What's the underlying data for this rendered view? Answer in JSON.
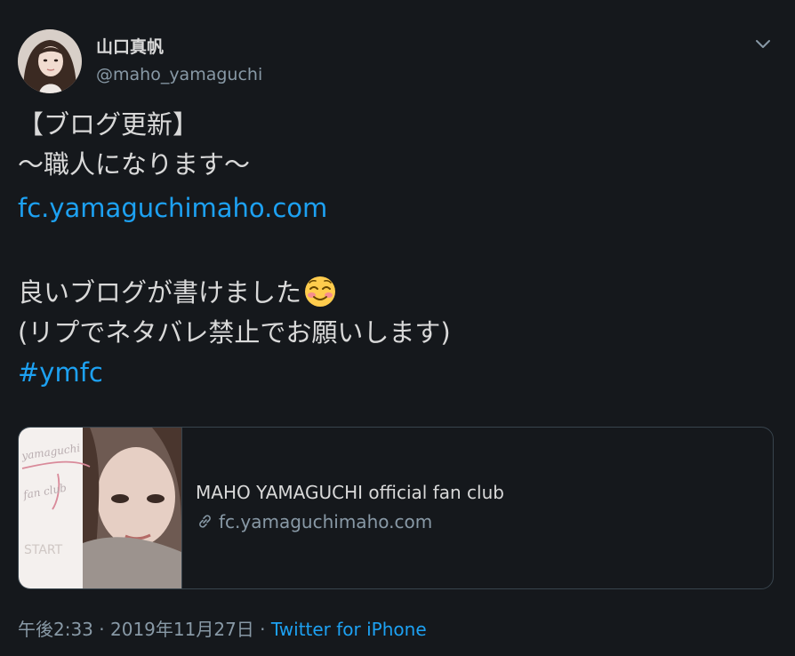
{
  "author": {
    "display_name": "山口真帆",
    "handle": "@maho_yamaguchi"
  },
  "tweet": {
    "line1": "【ブログ更新】",
    "line2": "〜職人になります〜",
    "link": "fc.yamaguchimaho.com",
    "line4": "良いブログが書けました",
    "line4_emoji": "smiling-face-icon",
    "line5": "(リプでネタバレ禁止でお願いします)",
    "hashtag": "#ymfc"
  },
  "card": {
    "title": "MAHO YAMAGUCHI official fan club",
    "domain": "fc.yamaguchimaho.com",
    "thumb_text_1": "yamaguchi",
    "thumb_text_2": "fan club",
    "thumb_text_3": "START"
  },
  "meta": {
    "time": "午後2:33",
    "separator1": "·",
    "date": "2019年11月27日",
    "separator2": "·",
    "source": "Twitter for iPhone"
  },
  "colors": {
    "background": "#15181c",
    "text": "#d9d9d9",
    "muted": "#8899a6",
    "accent": "#1da1f2",
    "border": "#38444d"
  }
}
